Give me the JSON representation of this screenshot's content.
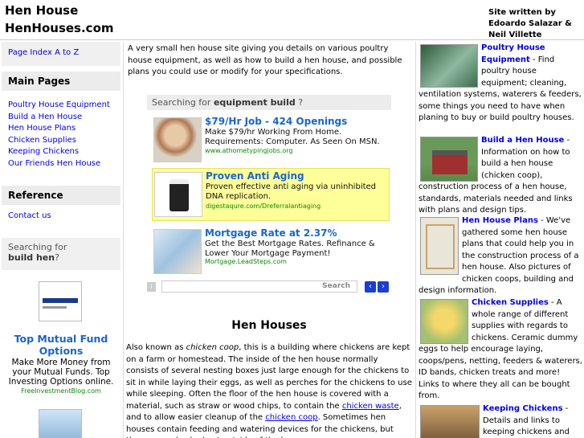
{
  "header": {
    "site_title_line1": "Hen House",
    "site_title_line2": "HenHouses.com",
    "credits": "Site written by Edoardo Salazar & Neil Villette"
  },
  "left": {
    "index_link": "Page Index A to Z",
    "main_pages_heading": "Main Pages",
    "main_pages": [
      "Poultry House Equipment",
      "Build a Hen House",
      "Hen House Plans",
      "Chicken Supplies",
      "Keeping Chickens",
      "Our Friends Hen House"
    ],
    "reference_heading": "Reference",
    "contact_link": "Contact us",
    "search_prefix": "Searching for",
    "search_term": "build hen",
    "search_suffix": "?",
    "ad": {
      "title": "Top Mutual Fund Options",
      "text": "Make More Money from your Mutual Funds. Top Investing Options online.",
      "url": "FreeInvestmentBlog.com",
      "logo_text": "FreeInvestmentBlog.com"
    }
  },
  "center": {
    "intro": "A very small hen house site giving you details on various poultry house equipment, as well as how to build a hen house, and possible plans you could use or modify for your specifications.",
    "ad_search_prefix": "Searching for",
    "ad_search_term": "equipment build",
    "ad_search_suffix": "?",
    "ads": [
      {
        "title": "$79/Hr Job - 424 Openings",
        "text": "Make $79/hr Working From Home. Requirements: Computer. As Seen On MSN.",
        "url": "www.athometypingjobs.org"
      },
      {
        "title": "Proven Anti Aging",
        "text": "Proven effective anti aging via uninhibited DNA replication.",
        "url": "digestaqure.com/Dreferralantiaging"
      },
      {
        "title": "Mortgage Rate at 2.37%",
        "text": "Get the Best Mortgage Rates. Refinance & Lower Your Mortgage Payment!",
        "url": "Mortgage.LeadSteps.com"
      }
    ],
    "pager": {
      "info": "i",
      "search_label": "Search",
      "prev": "‹",
      "next": "›"
    },
    "content_title": "Hen Houses",
    "body": {
      "p1_a": "Also known as ",
      "p1_em": "chicken coop",
      "p1_b": ", this is a building where chickens are kept on a farm or homestead. The inside of the hen house normally consists of several nesting boxes just large enough for the chickens to sit in while laying their eggs, as well as perches for the chickens to use while sleeping. Often the floor of the hen house is covered with a material, such as straw or wood chips, to contain the ",
      "link1": "chicken waste",
      "p1_c": ", and to allow easier cleanup of the ",
      "link2": "chicken coop",
      "p1_d": ". Sometimes hen houses contain feeding and watering devices for the chickens, but these may also be kept outside of the house."
    }
  },
  "right": {
    "sections": [
      {
        "title": "Poultry House Equipment",
        "text": " - Find poultry house equipment; cleaning, ventilation systems, waterers & feeders, some things you need to have when planing to buy or build poultry houses."
      },
      {
        "title": "Build a Hen House",
        "text": " - Information on how to build a hen house (chicken coop), construction process of a hen house, standards, materials needed and links with plans and design tips."
      },
      {
        "title": "Hen House Plans",
        "text": " - We've gathered some hen house plans that could help you in the construction process of a hen house. Also pictures of chicken coops, building and design information."
      },
      {
        "title": "Chicken Supplies",
        "text": " - A whole range of different supplies with regards to chickens. Ceramic dummy eggs to help encourage laying, coops/pens, netting, feeders & waterers, ID bands, chicken treats and more! Links to where they all can be bought from."
      },
      {
        "title": "Keeping Chickens",
        "text": " - Details and links to keeping chickens and what is"
      }
    ]
  },
  "colors": {
    "link": "#0000ee",
    "ad_title": "#1a66cc",
    "ad_url": "#0a8a0a",
    "ad_highlight": "#ffff99",
    "panel_gray": "#ececec"
  }
}
